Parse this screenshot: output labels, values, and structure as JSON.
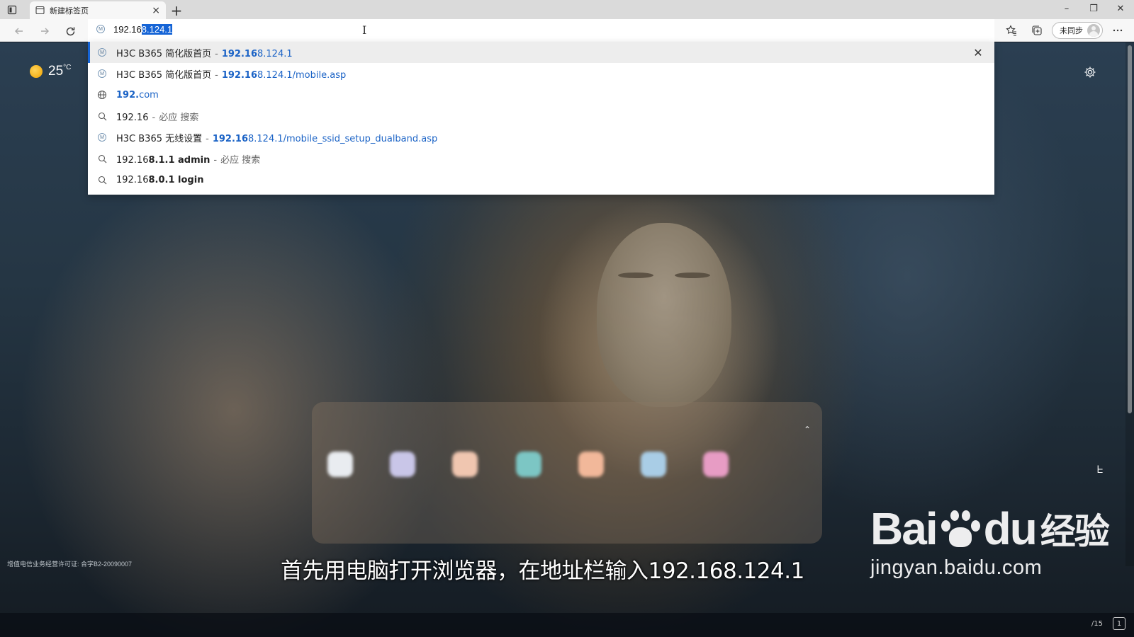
{
  "tab": {
    "title": "新建标签页",
    "close": "×"
  },
  "new_tab_label": "+",
  "window": {
    "minimize": "–",
    "restore": "❐",
    "close": "✕"
  },
  "address": {
    "typed": "192.16",
    "autocomplete": "8.124.1"
  },
  "profile": {
    "label": "未同步"
  },
  "suggestions": [
    {
      "icon": "site-icon",
      "title": "H3C B365 简化版首页",
      "url_bold": "192.16",
      "url_rest": "8.124.1",
      "highlighted": true
    },
    {
      "icon": "site-icon",
      "title": "H3C B365 简化版首页",
      "url_bold": "192.16",
      "url_rest": "8.124.1/mobile.asp",
      "highlighted": false
    },
    {
      "icon": "globe-icon",
      "url_bold": "192.",
      "url_rest": "com",
      "highlighted": false
    },
    {
      "icon": "search-icon",
      "query": "192.16",
      "query_bold": "",
      "engine": "必应 搜索",
      "highlighted": false
    },
    {
      "icon": "site-icon",
      "title": "H3C B365 无线设置",
      "url_bold": "192.16",
      "url_rest": "8.124.1/mobile_ssid_setup_dualband.asp",
      "highlighted": false
    },
    {
      "icon": "search-icon",
      "query": "192.16",
      "query_bold": "8.1.1 admin",
      "engine": "必应 搜索",
      "highlighted": false
    },
    {
      "icon": "search-icon",
      "query": "192.16",
      "query_bold": "8.0.1 login",
      "engine": "",
      "highlighted": false
    }
  ],
  "weather": {
    "temp": "25",
    "unit": "°C"
  },
  "license_text": "增值电信业务经营许可证: 合字B2-20090007",
  "subtitle": "首先用电脑打开浏览器，在地址栏输入192.168.124.1",
  "watermark": {
    "brand_left": "Bai",
    "brand_right": "du",
    "brand_cn": "经验",
    "url": "jingyan.baidu.com"
  },
  "tray": {
    "text": "/15",
    "notif": "1"
  },
  "colors": {
    "accent": "#1564d6",
    "link": "#1b63c6"
  }
}
